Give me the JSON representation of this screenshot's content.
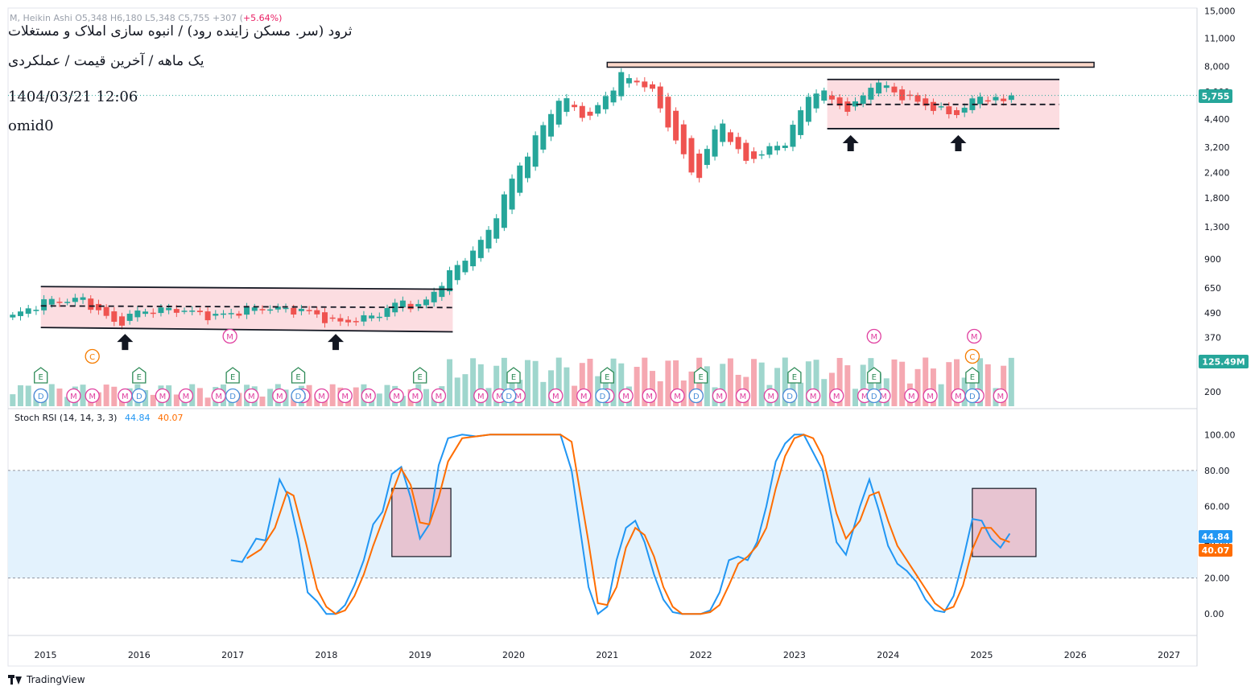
{
  "header": {
    "title_line1": "ثرود (سر. مسکن زاینده رود) / انبوه سازی املاک و مستغلات",
    "title_line2": "یک ماهه / آخرین قیمت / عملکردی",
    "datetime": "1404/03/21 12:06",
    "author": "omid0",
    "ohlc_text": "M, Heikin Ashi  O5,348  H6,180  L5,348  C5,755  +307 (",
    "ohlc_change": "+5.64%)"
  },
  "stoch_legend": {
    "label": "Stoch RSI (14, 14, 3, 3)",
    "k_value": "44.84",
    "d_value": "40.07"
  },
  "brand": {
    "name": "TradingView"
  },
  "colors": {
    "up": "#26a69a",
    "down": "#ef5350",
    "vol_up": "#9fd6cd",
    "vol_down": "#f5a8b1",
    "k_line": "#2196f3",
    "d_line": "#ff6d00",
    "band_fill": "#e3f2fd",
    "rect_fill": "#fcd7dc"
  },
  "chart_data": [
    {
      "type": "candlestick",
      "style": "Heikin Ashi",
      "interval": "1M",
      "scale": "log",
      "ylim": [
        170,
        15500
      ],
      "y_ticks": [
        "15,000",
        "11,000",
        "8,000",
        "6,000",
        "4,400",
        "3,200",
        "2,400",
        "1,800",
        "1,300",
        "900",
        "650",
        "490",
        "370",
        "200"
      ],
      "x_ticks": [
        "2015",
        "2016",
        "2017",
        "2018",
        "2019",
        "2020",
        "2021",
        "2022",
        "2023",
        "2024",
        "2025",
        "2026",
        "2027"
      ],
      "x_range": [
        2014.6,
        2027.3
      ],
      "last_price_label": "5,755",
      "last_price": 5755,
      "volume_label": "125.49M",
      "anchors": [
        [
          2014.65,
          470
        ],
        [
          2015.0,
          560
        ],
        [
          2015.4,
          570
        ],
        [
          2015.75,
          430
        ],
        [
          2016.0,
          500
        ],
        [
          2016.4,
          510
        ],
        [
          2016.8,
          470
        ],
        [
          2017.3,
          520
        ],
        [
          2017.8,
          500
        ],
        [
          2018.1,
          435
        ],
        [
          2018.5,
          470
        ],
        [
          2018.8,
          560
        ],
        [
          2019.0,
          520
        ],
        [
          2019.3,
          750
        ],
        [
          2019.7,
          1150
        ],
        [
          2020.0,
          2300
        ],
        [
          2020.5,
          5700
        ],
        [
          2020.8,
          4400
        ],
        [
          2021.15,
          7200
        ],
        [
          2021.45,
          6400
        ],
        [
          2021.95,
          2150
        ],
        [
          2022.2,
          4500
        ],
        [
          2022.45,
          2700
        ],
        [
          2022.9,
          3400
        ],
        [
          2023.2,
          6300
        ],
        [
          2023.6,
          4800
        ],
        [
          2023.85,
          6800
        ],
        [
          2024.15,
          5700
        ],
        [
          2024.7,
          4600
        ],
        [
          2025.0,
          5800
        ],
        [
          2025.25,
          5300
        ],
        [
          2025.35,
          5755
        ]
      ],
      "annotations": {
        "resistance_line": 8150,
        "left_channel": {
          "x": [
            2014.95,
            2019.35
          ],
          "top": [
            660,
            640
          ],
          "bottom": [
            415,
            395
          ],
          "mid": [
            530,
            520
          ]
        },
        "right_channel": {
          "x": [
            2023.35,
            2025.83
          ],
          "top": 6900,
          "bottom": 3950,
          "mid": 5200
        },
        "up_arrows": [
          2015.85,
          2018.1,
          2023.6,
          2024.75
        ]
      },
      "event_markers": {
        "M": [
          2014.95,
          2015.3,
          2015.5,
          2015.85,
          2016.25,
          2016.5,
          2016.85,
          2017.2,
          2017.5,
          2017.75,
          2017.95,
          2018.2,
          2018.45,
          2018.75,
          2018.95,
          2019.2,
          2019.65,
          2019.85,
          2020.05,
          2020.45,
          2020.75,
          2021.0,
          2021.2,
          2021.45,
          2021.75,
          2021.95,
          2022.2,
          2022.45,
          2022.75,
          2022.95,
          2023.2,
          2023.45,
          2023.75,
          2023.95,
          2024.25,
          2024.45,
          2024.75,
          2024.95,
          2025.2
        ],
        "D": [
          2014.95,
          2016.0,
          2017.0,
          2017.7,
          2019.95,
          2020.95,
          2021.95,
          2022.95,
          2023.85,
          2024.9
        ],
        "E": [
          2014.95,
          2016.0,
          2017.0,
          2017.7,
          2019.0,
          2020.0,
          2021.0,
          2022.0,
          2023.0,
          2023.85,
          2024.9
        ],
        "C": [
          2015.5,
          2024.9
        ],
        "M_high": [
          2016.97,
          2023.85,
          2024.92
        ]
      }
    },
    {
      "type": "line",
      "name": "Stoch RSI (14, 14, 3, 3)",
      "ylim": [
        -12,
        110
      ],
      "y_ticks": [
        "100.00",
        "80.00",
        "60.00",
        "40.00",
        "20.00",
        "0.00"
      ],
      "band": [
        20,
        80
      ],
      "series": [
        {
          "name": "K",
          "values": "44.84",
          "points": [
            [
              2016.98,
              30
            ],
            [
              2017.1,
              29
            ],
            [
              2017.25,
              42
            ],
            [
              2017.35,
              41
            ],
            [
              2017.5,
              75
            ],
            [
              2017.6,
              65
            ],
            [
              2017.7,
              42
            ],
            [
              2017.8,
              12
            ],
            [
              2017.9,
              7
            ],
            [
              2018.0,
              0
            ],
            [
              2018.1,
              0
            ],
            [
              2018.2,
              5
            ],
            [
              2018.3,
              16
            ],
            [
              2018.4,
              30
            ],
            [
              2018.5,
              50
            ],
            [
              2018.6,
              57
            ],
            [
              2018.7,
              78
            ],
            [
              2018.8,
              82
            ],
            [
              2018.9,
              65
            ],
            [
              2019.0,
              42
            ],
            [
              2019.1,
              50
            ],
            [
              2019.2,
              83
            ],
            [
              2019.3,
              98
            ],
            [
              2019.45,
              100
            ],
            [
              2019.6,
              99
            ],
            [
              2019.75,
              100
            ],
            [
              2020.0,
              100
            ],
            [
              2020.3,
              100
            ],
            [
              2020.5,
              100
            ],
            [
              2020.62,
              80
            ],
            [
              2020.8,
              15
            ],
            [
              2020.9,
              0
            ],
            [
              2021.0,
              4
            ],
            [
              2021.1,
              30
            ],
            [
              2021.2,
              48
            ],
            [
              2021.3,
              52
            ],
            [
              2021.4,
              40
            ],
            [
              2021.5,
              22
            ],
            [
              2021.6,
              8
            ],
            [
              2021.7,
              1
            ],
            [
              2021.8,
              0
            ],
            [
              2021.9,
              0
            ],
            [
              2022.0,
              0
            ],
            [
              2022.1,
              2
            ],
            [
              2022.2,
              12
            ],
            [
              2022.3,
              30
            ],
            [
              2022.4,
              32
            ],
            [
              2022.5,
              30
            ],
            [
              2022.6,
              40
            ],
            [
              2022.7,
              60
            ],
            [
              2022.8,
              85
            ],
            [
              2022.9,
              95
            ],
            [
              2023.0,
              100
            ],
            [
              2023.1,
              100
            ],
            [
              2023.2,
              90
            ],
            [
              2023.3,
              80
            ],
            [
              2023.45,
              40
            ],
            [
              2023.55,
              33
            ],
            [
              2023.7,
              60
            ],
            [
              2023.8,
              75
            ],
            [
              2023.9,
              58
            ],
            [
              2024.0,
              38
            ],
            [
              2024.1,
              28
            ],
            [
              2024.2,
              24
            ],
            [
              2024.3,
              18
            ],
            [
              2024.4,
              8
            ],
            [
              2024.5,
              2
            ],
            [
              2024.6,
              1
            ],
            [
              2024.7,
              10
            ],
            [
              2024.8,
              30
            ],
            [
              2024.9,
              53
            ],
            [
              2025.0,
              52
            ],
            [
              2025.1,
              42
            ],
            [
              2025.2,
              37
            ],
            [
              2025.3,
              44.84
            ]
          ]
        },
        {
          "name": "D",
          "values": "40.07",
          "points": [
            [
              2017.15,
              31
            ],
            [
              2017.3,
              36
            ],
            [
              2017.45,
              48
            ],
            [
              2017.58,
              68
            ],
            [
              2017.65,
              66
            ],
            [
              2017.78,
              40
            ],
            [
              2017.9,
              14
            ],
            [
              2018.0,
              4
            ],
            [
              2018.1,
              0
            ],
            [
              2018.2,
              2
            ],
            [
              2018.3,
              10
            ],
            [
              2018.4,
              22
            ],
            [
              2018.5,
              38
            ],
            [
              2018.6,
              52
            ],
            [
              2018.7,
              67
            ],
            [
              2018.8,
              81
            ],
            [
              2018.9,
              72
            ],
            [
              2019.0,
              51
            ],
            [
              2019.1,
              50
            ],
            [
              2019.2,
              65
            ],
            [
              2019.3,
              85
            ],
            [
              2019.45,
              98
            ],
            [
              2019.6,
              99
            ],
            [
              2019.75,
              100
            ],
            [
              2020.0,
              100
            ],
            [
              2020.3,
              100
            ],
            [
              2020.5,
              100
            ],
            [
              2020.62,
              96
            ],
            [
              2020.8,
              40
            ],
            [
              2020.9,
              6
            ],
            [
              2021.0,
              5
            ],
            [
              2021.1,
              15
            ],
            [
              2021.2,
              37
            ],
            [
              2021.3,
              48
            ],
            [
              2021.4,
              44
            ],
            [
              2021.5,
              32
            ],
            [
              2021.6,
              15
            ],
            [
              2021.7,
              4
            ],
            [
              2021.8,
              0
            ],
            [
              2021.9,
              0
            ],
            [
              2022.0,
              0
            ],
            [
              2022.1,
              1
            ],
            [
              2022.2,
              5
            ],
            [
              2022.3,
              16
            ],
            [
              2022.4,
              28
            ],
            [
              2022.5,
              32
            ],
            [
              2022.6,
              38
            ],
            [
              2022.7,
              48
            ],
            [
              2022.8,
              70
            ],
            [
              2022.9,
              88
            ],
            [
              2023.0,
              98
            ],
            [
              2023.1,
              100
            ],
            [
              2023.2,
              98
            ],
            [
              2023.3,
              88
            ],
            [
              2023.45,
              56
            ],
            [
              2023.55,
              42
            ],
            [
              2023.7,
              52
            ],
            [
              2023.8,
              66
            ],
            [
              2023.9,
              68
            ],
            [
              2024.0,
              52
            ],
            [
              2024.1,
              38
            ],
            [
              2024.2,
              30
            ],
            [
              2024.3,
              22
            ],
            [
              2024.4,
              14
            ],
            [
              2024.5,
              6
            ],
            [
              2024.6,
              2
            ],
            [
              2024.7,
              4
            ],
            [
              2024.8,
              16
            ],
            [
              2024.9,
              36
            ],
            [
              2025.0,
              48
            ],
            [
              2025.1,
              48
            ],
            [
              2025.2,
              42
            ],
            [
              2025.3,
              40.07
            ]
          ]
        }
      ],
      "highlight_boxes": [
        [
          2018.7,
          2019.33
        ],
        [
          2024.9,
          2025.58
        ]
      ]
    }
  ]
}
